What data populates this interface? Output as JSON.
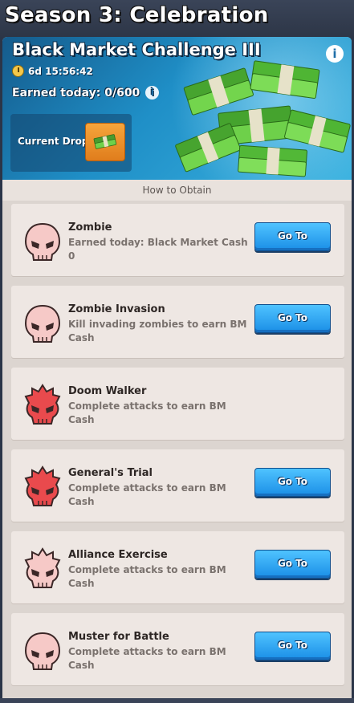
{
  "header": {
    "season_title": "Season 3: Celebration"
  },
  "banner": {
    "title": "Black Market Challenge III",
    "timer": "6d 15:56:42",
    "earned_today": "Earned today: 0/600",
    "current_drop_label": "Current Drop:"
  },
  "section": {
    "title": "How to Obtain"
  },
  "tasks": [
    {
      "title": "Zombie",
      "desc": "Earned today: Black Market Cash 0",
      "button": "Go To",
      "icon": "pink-skull-icon"
    },
    {
      "title": "Zombie Invasion",
      "desc": "Kill invading zombies to earn BM Cash",
      "button": "Go To",
      "icon": "pink-skull-icon"
    },
    {
      "title": "Doom Walker",
      "desc": "Complete attacks to earn BM Cash",
      "button": "",
      "icon": "red-spiked-skull-icon"
    },
    {
      "title": "General's Trial",
      "desc": "Complete attacks to earn BM Cash",
      "button": "Go To",
      "icon": "red-spiked-skull-icon"
    },
    {
      "title": "Alliance Exercise",
      "desc": "Complete attacks to earn BM Cash",
      "button": "Go To",
      "icon": "pink-spiked-skull-icon"
    },
    {
      "title": "Muster for Battle",
      "desc": "Complete attacks to earn BM Cash",
      "button": "Go To",
      "icon": "pink-skull-icon"
    }
  ],
  "colors": {
    "accent_button": "#1a8ee6",
    "pink_skull": "#f6c9c7",
    "red_skull": "#e94a4d",
    "drop_background": "#f6a53c"
  }
}
